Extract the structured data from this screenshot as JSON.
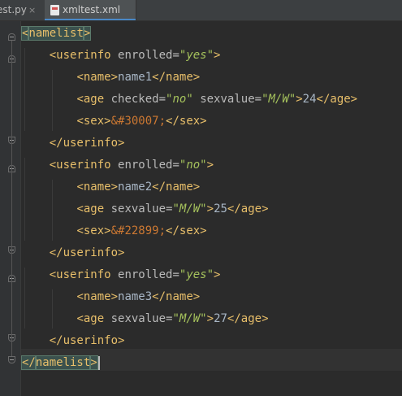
{
  "tabs": [
    {
      "label": "est.py",
      "close": "×"
    },
    {
      "label": "xmltest.xml"
    }
  ],
  "lines": [
    {
      "parts": [
        {
          "t": "<",
          "c": "match"
        },
        {
          "t": "namelist",
          "c": "match"
        },
        {
          "t": ">",
          "c": "match"
        }
      ]
    },
    {
      "parts": [
        {
          "t": "<userinfo ",
          "c": "tag"
        },
        {
          "t": "enrolled",
          "c": "attr"
        },
        {
          "t": "=",
          "c": "attr"
        },
        {
          "t": "\"yes\"",
          "c": "val"
        },
        {
          "t": ">",
          "c": "tag"
        }
      ]
    },
    {
      "parts": [
        {
          "t": "<name>",
          "c": "tag"
        },
        {
          "t": "name1",
          "c": "txt"
        },
        {
          "t": "</name>",
          "c": "tag"
        }
      ]
    },
    {
      "parts": [
        {
          "t": "<age ",
          "c": "tag"
        },
        {
          "t": "checked",
          "c": "attr"
        },
        {
          "t": "=",
          "c": "attr"
        },
        {
          "t": "\"no\"",
          "c": "val"
        },
        {
          "t": " ",
          "c": "txt"
        },
        {
          "t": "sexvalue",
          "c": "attr"
        },
        {
          "t": "=",
          "c": "attr"
        },
        {
          "t": "\"M/W\"",
          "c": "val"
        },
        {
          "t": ">",
          "c": "tag"
        },
        {
          "t": "24",
          "c": "txt"
        },
        {
          "t": "</age>",
          "c": "tag"
        }
      ]
    },
    {
      "parts": [
        {
          "t": "<sex>",
          "c": "tag"
        },
        {
          "t": "&#30007;",
          "c": "ent"
        },
        {
          "t": "</sex>",
          "c": "tag"
        }
      ]
    },
    {
      "parts": [
        {
          "t": "</userinfo>",
          "c": "tag"
        }
      ]
    },
    {
      "parts": [
        {
          "t": "<userinfo ",
          "c": "tag"
        },
        {
          "t": "enrolled",
          "c": "attr"
        },
        {
          "t": "=",
          "c": "attr"
        },
        {
          "t": "\"no\"",
          "c": "val"
        },
        {
          "t": ">",
          "c": "tag"
        }
      ]
    },
    {
      "parts": [
        {
          "t": "<name>",
          "c": "tag"
        },
        {
          "t": "name2",
          "c": "txt"
        },
        {
          "t": "</name>",
          "c": "tag"
        }
      ]
    },
    {
      "parts": [
        {
          "t": "<age ",
          "c": "tag"
        },
        {
          "t": "sexvalue",
          "c": "attr"
        },
        {
          "t": "=",
          "c": "attr"
        },
        {
          "t": "\"M/W\"",
          "c": "val"
        },
        {
          "t": ">",
          "c": "tag"
        },
        {
          "t": "25",
          "c": "txt"
        },
        {
          "t": "</age>",
          "c": "tag"
        }
      ]
    },
    {
      "parts": [
        {
          "t": "<sex>",
          "c": "tag"
        },
        {
          "t": "&#22899;",
          "c": "ent"
        },
        {
          "t": "</sex>",
          "c": "tag"
        }
      ]
    },
    {
      "parts": [
        {
          "t": "</userinfo>",
          "c": "tag"
        }
      ]
    },
    {
      "parts": [
        {
          "t": "<userinfo ",
          "c": "tag"
        },
        {
          "t": "enrolled",
          "c": "attr"
        },
        {
          "t": "=",
          "c": "attr"
        },
        {
          "t": "\"yes\"",
          "c": "val"
        },
        {
          "t": ">",
          "c": "tag"
        }
      ]
    },
    {
      "parts": [
        {
          "t": "<name>",
          "c": "tag"
        },
        {
          "t": "name3",
          "c": "txt"
        },
        {
          "t": "</name>",
          "c": "tag"
        }
      ]
    },
    {
      "parts": [
        {
          "t": "<age ",
          "c": "tag"
        },
        {
          "t": "sexvalue",
          "c": "attr"
        },
        {
          "t": "=",
          "c": "attr"
        },
        {
          "t": "\"M/W\"",
          "c": "val"
        },
        {
          "t": ">",
          "c": "tag"
        },
        {
          "t": "27",
          "c": "txt"
        },
        {
          "t": "</age>",
          "c": "tag"
        }
      ]
    },
    {
      "parts": [
        {
          "t": "</userinfo>",
          "c": "tag"
        }
      ]
    },
    {
      "parts": [
        {
          "t": "</",
          "c": "match"
        },
        {
          "t": "namelist",
          "c": "match"
        },
        {
          "t": ">",
          "c": "match"
        }
      ]
    }
  ],
  "colors": {
    "background": "#2b2b2b",
    "tag": "#e8bf6a",
    "attribute": "#bababa",
    "value": "#a5c25c",
    "entity": "#cc7832",
    "text": "#a9b7c6",
    "tag_match_highlight": "#3b514d"
  },
  "icons": {
    "file_tab": "xml-file-icon",
    "fold": "fold-marker-icon"
  }
}
